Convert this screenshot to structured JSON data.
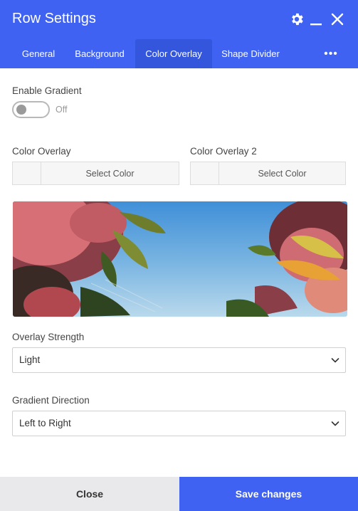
{
  "window": {
    "title": "Row Settings",
    "icons": [
      "gear-icon",
      "minimize-icon",
      "close-icon"
    ]
  },
  "tabs": [
    {
      "label": "General",
      "active": false
    },
    {
      "label": "Background",
      "active": false
    },
    {
      "label": "Color Overlay",
      "active": true
    },
    {
      "label": "Shape Divider",
      "active": false
    }
  ],
  "more_tabs_icon": "more-horizontal-icon",
  "gradient": {
    "label": "Enable Gradient",
    "state_text": "Off",
    "enabled": false
  },
  "color_overlay": {
    "label": "Color Overlay",
    "button_text": "Select Color"
  },
  "color_overlay_2": {
    "label": "Color Overlay 2",
    "button_text": "Select Color"
  },
  "overlay_strength": {
    "label": "Overlay Strength",
    "value": "Light"
  },
  "gradient_direction": {
    "label": "Gradient Direction",
    "value": "Left to Right"
  },
  "footer": {
    "close_label": "Close",
    "save_label": "Save changes"
  },
  "colors": {
    "accent": "#3f62f2",
    "active_tab": "#3456dc",
    "close_button_bg": "#e9e9eb"
  }
}
